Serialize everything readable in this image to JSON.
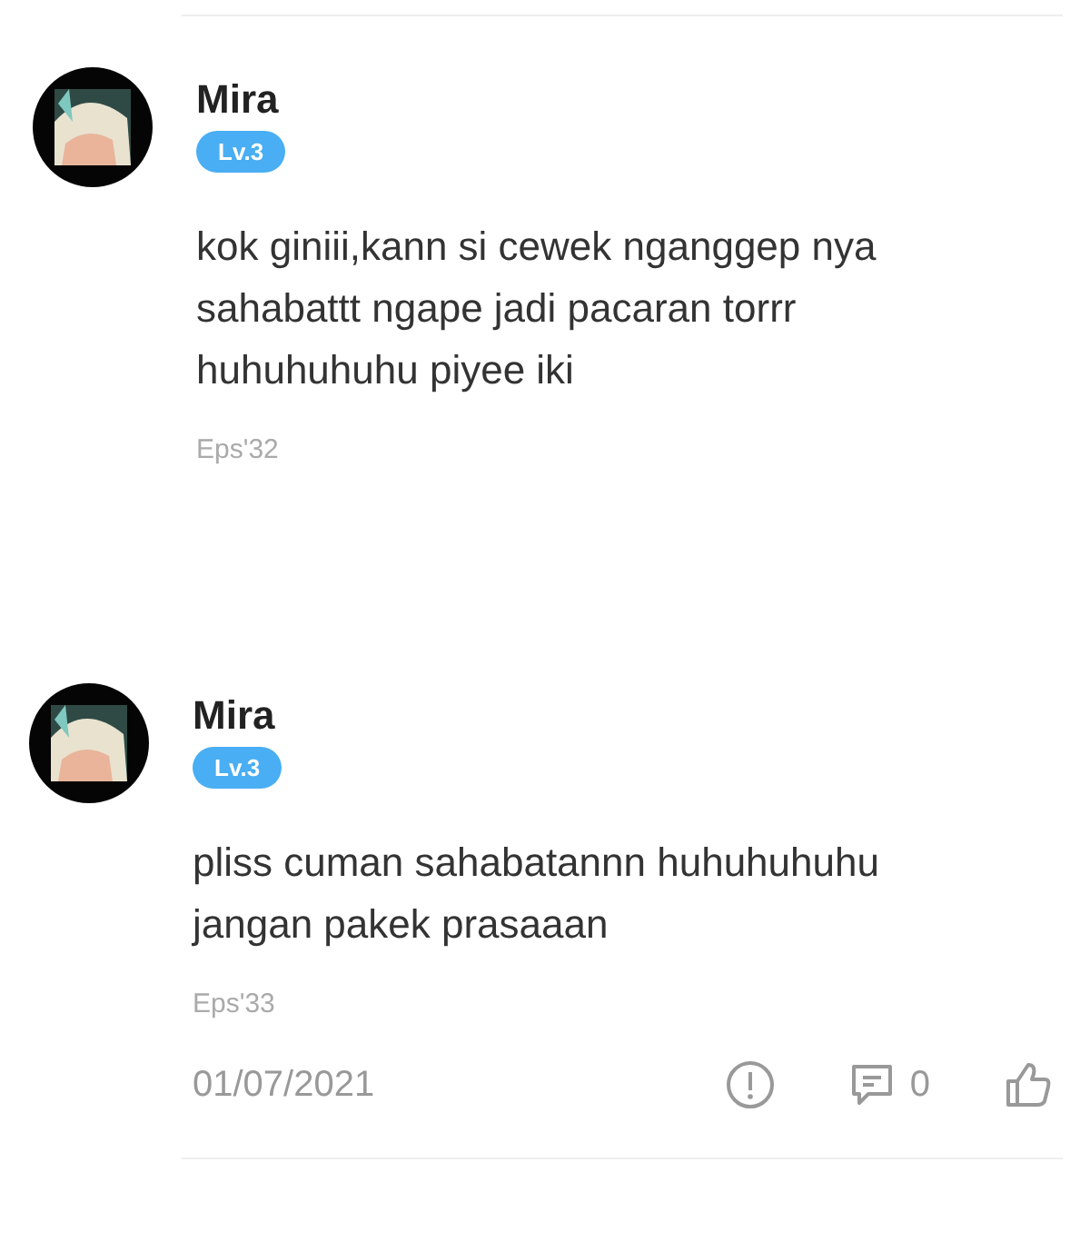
{
  "comments": [
    {
      "name": "Mira",
      "level": "Lv.3",
      "text": "kok giniii,kann si cewek nganggep nya sahabattt ngape jadi pacaran torrr huhuhuhuhu piyee iki",
      "episode": "Eps'32"
    },
    {
      "name": "Mira",
      "level": "Lv.3",
      "text": "pliss cuman sahabatannn huhuhuhuhu jangan pakek prasaaan",
      "episode": "Eps'33",
      "date": "01/07/2021",
      "reply_count": "0"
    }
  ]
}
